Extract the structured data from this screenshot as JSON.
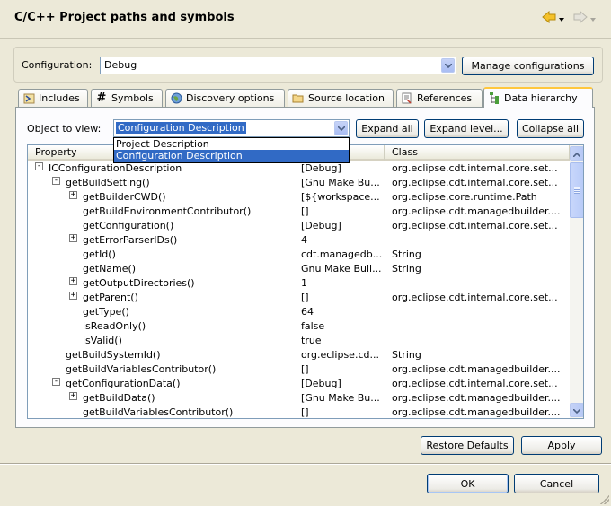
{
  "dialog": {
    "title": "C/C++ Project paths and symbols"
  },
  "configuration": {
    "label": "Configuration:",
    "value": "Debug",
    "manage_label": "Manage configurations"
  },
  "tabs": [
    {
      "label": "Includes",
      "icon": "includes-icon"
    },
    {
      "label": "Symbols",
      "icon": "hash-icon"
    },
    {
      "label": "Discovery options",
      "icon": "globe-icon"
    },
    {
      "label": "Source location",
      "icon": "folder-icon"
    },
    {
      "label": "References",
      "icon": "references-icon"
    },
    {
      "label": "Data hierarchy",
      "icon": "hierarchy-icon"
    }
  ],
  "object_view": {
    "label": "Object to view:",
    "value": "Configuration Description",
    "options": [
      "Project Description",
      "Configuration Description"
    ],
    "expand_all": "Expand all",
    "expand_level": "Expand level...",
    "collapse_all": "Collapse all"
  },
  "table": {
    "columns": [
      "Property",
      "Class"
    ],
    "rows": [
      {
        "name": "ICConfigurationDescription",
        "value": "[Debug]",
        "cls": "org.eclipse.cdt.internal.core.set..."
      },
      {
        "name": "getBuildSetting()",
        "value": "[Gnu Make Bu...",
        "cls": "org.eclipse.cdt.internal.core.set..."
      },
      {
        "name": "getBuilderCWD()",
        "value": "[${workspace...",
        "cls": "org.eclipse.core.runtime.Path"
      },
      {
        "name": "getBuildEnvironmentContributor()",
        "value": "[]",
        "cls": "org.eclipse.cdt.managedbuilder...."
      },
      {
        "name": "getConfiguration()",
        "value": "[Debug]",
        "cls": "org.eclipse.cdt.internal.core.set..."
      },
      {
        "name": "getErrorParserIDs()",
        "value": "4",
        "cls": ""
      },
      {
        "name": "getId()",
        "value": "cdt.managedb...",
        "cls": "String"
      },
      {
        "name": "getName()",
        "value": "Gnu Make Buil...",
        "cls": "String"
      },
      {
        "name": "getOutputDirectories()",
        "value": "1",
        "cls": ""
      },
      {
        "name": "getParent()",
        "value": "[]",
        "cls": "org.eclipse.cdt.internal.core.set..."
      },
      {
        "name": "getType()",
        "value": "64",
        "cls": ""
      },
      {
        "name": "isReadOnly()",
        "value": "false",
        "cls": ""
      },
      {
        "name": "isValid()",
        "value": "true",
        "cls": ""
      },
      {
        "name": "getBuildSystemId()",
        "value": "org.eclipse.cd...",
        "cls": "String"
      },
      {
        "name": "getBuildVariablesContributor()",
        "value": "[]",
        "cls": "org.eclipse.cdt.managedbuilder...."
      },
      {
        "name": "getConfigurationData()",
        "value": "[Debug]",
        "cls": "org.eclipse.cdt.internal.core.set..."
      },
      {
        "name": "getBuildData()",
        "value": "[Gnu Make Bu...",
        "cls": "org.eclipse.cdt.managedbuilder...."
      },
      {
        "name": "getBuildVariablesContributor()",
        "value": "[]",
        "cls": "org.eclipse.cdt.managedbuilder...."
      }
    ]
  },
  "footer": {
    "restore_defaults": "Restore Defaults",
    "apply": "Apply",
    "ok": "OK",
    "cancel": "Cancel"
  },
  "colors": {
    "selection": "#316ac5",
    "tab_accent": "#ffc73c",
    "window_bg": "#ece9d8"
  }
}
